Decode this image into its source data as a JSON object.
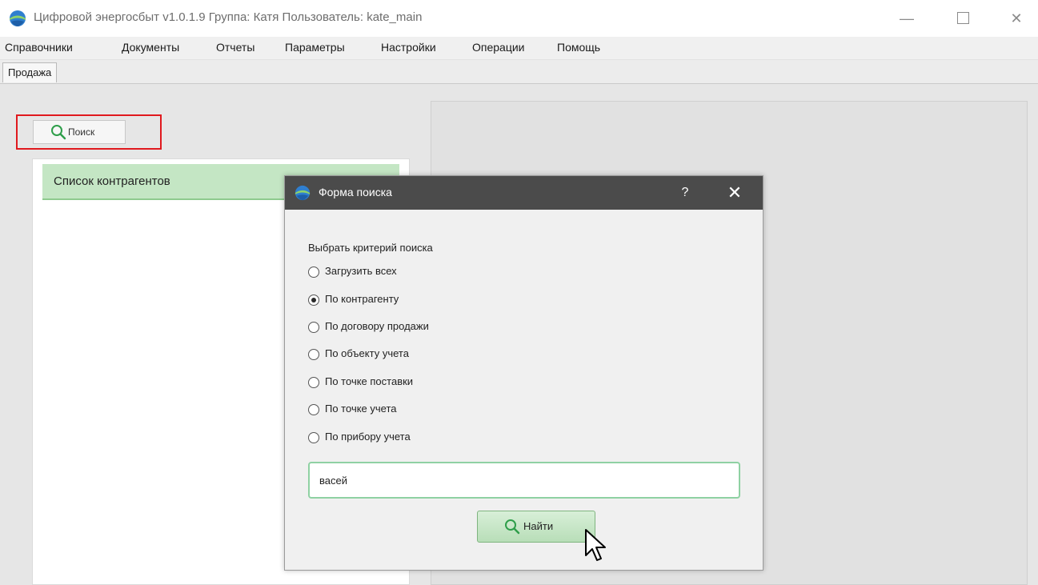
{
  "window": {
    "title": "Цифровой энергосбыт v1.0.1.9 Группа: Катя Пользователь: kate_main",
    "minimize_glyph": "—",
    "close_glyph": "✕"
  },
  "menu": [
    "Справочники",
    "Документы",
    "Отчеты",
    "Параметры",
    "Настройки",
    "Операции",
    "Помощь"
  ],
  "tabs": [
    {
      "label": "Продажа"
    }
  ],
  "toolbar": {
    "search_label": "Поиск"
  },
  "list": {
    "header": "Список контрагентов"
  },
  "dialog": {
    "title": "Форма поиска",
    "help_glyph": "?",
    "close_glyph": "✕",
    "criteria_label": "Выбрать критерий поиска",
    "options": [
      {
        "label": "Загрузить всех",
        "selected": false
      },
      {
        "label": "По контрагенту",
        "selected": true
      },
      {
        "label": "По договору продажи",
        "selected": false
      },
      {
        "label": "По объекту учета",
        "selected": false
      },
      {
        "label": "По точке поставки",
        "selected": false
      },
      {
        "label": "По точке учета",
        "selected": false
      },
      {
        "label": "По прибору учета",
        "selected": false
      }
    ],
    "search_value": "васей",
    "find_label": "Найти"
  },
  "colors": {
    "highlight_border": "#e0191e",
    "dialog_titlebar": "#4b4b4b",
    "list_header_bg": "#c4e6c4",
    "input_border": "#8fd1a3",
    "icon_green": "#2e9e4a"
  },
  "icons": [
    "app-globe-icon",
    "search-icon",
    "cursor-icon"
  ]
}
